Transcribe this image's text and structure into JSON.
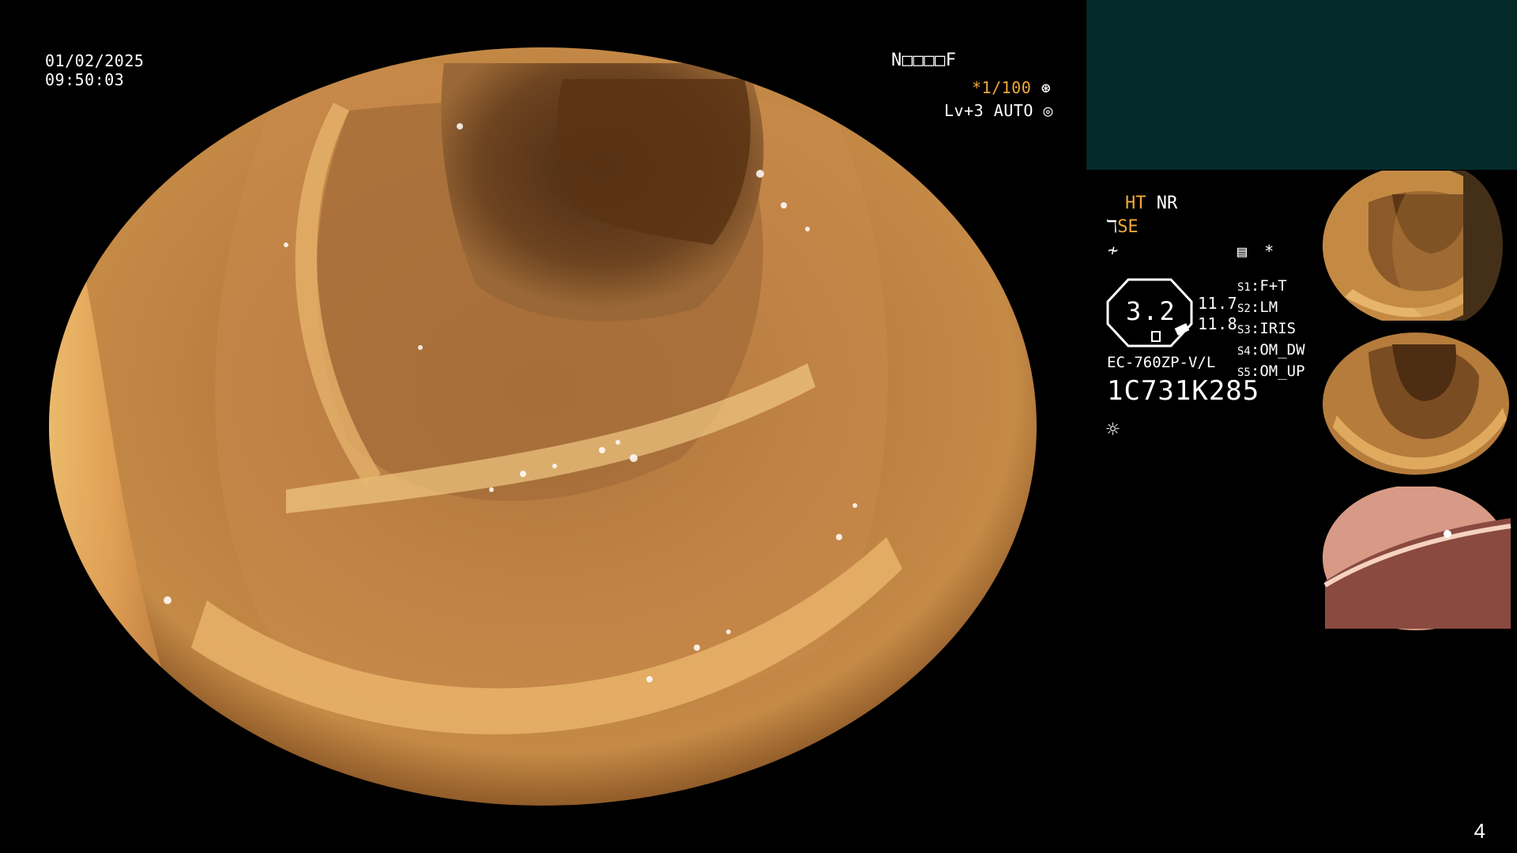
{
  "osd": {
    "date": "01/02/2025",
    "time": "09:50:03",
    "patient_id": "N□□□□F",
    "shutter": "*1/100",
    "shutter_icon": "aperture-icon",
    "level": "Lv+3 AUTO",
    "level_icon": "iris-icon"
  },
  "side_panel": {
    "enhance_1": "HT",
    "enhance_2": "NR",
    "mode": "SE",
    "mode_icon": "scope-icon",
    "freq_icon": "f-icon",
    "magnification": "3.2",
    "value_top": "11.7",
    "value_bottom": "11.8",
    "memo_icon": "memo-icon",
    "star": "*",
    "model": "EC-760ZP-V/L",
    "serial": "1C731K285",
    "light_icon": "brightness-icon",
    "switches": [
      {
        "key": "S1",
        "value": "F+T"
      },
      {
        "key": "S2",
        "value": "LM"
      },
      {
        "key": "S3",
        "value": "IRIS"
      },
      {
        "key": "S4",
        "value": "OM_DW"
      },
      {
        "key": "S5",
        "value": "OM_UP"
      }
    ]
  },
  "thumbnails": [
    {
      "label": "colon-fold-thumbnail-1"
    },
    {
      "label": "colon-fold-thumbnail-2"
    },
    {
      "label": "colon-mucosa-thumbnail-3"
    }
  ],
  "page_number": "4",
  "colors": {
    "background": "#000000",
    "accent_orange": "#f2a93b",
    "panel_teal": "#032a28",
    "text": "#ffffff"
  }
}
